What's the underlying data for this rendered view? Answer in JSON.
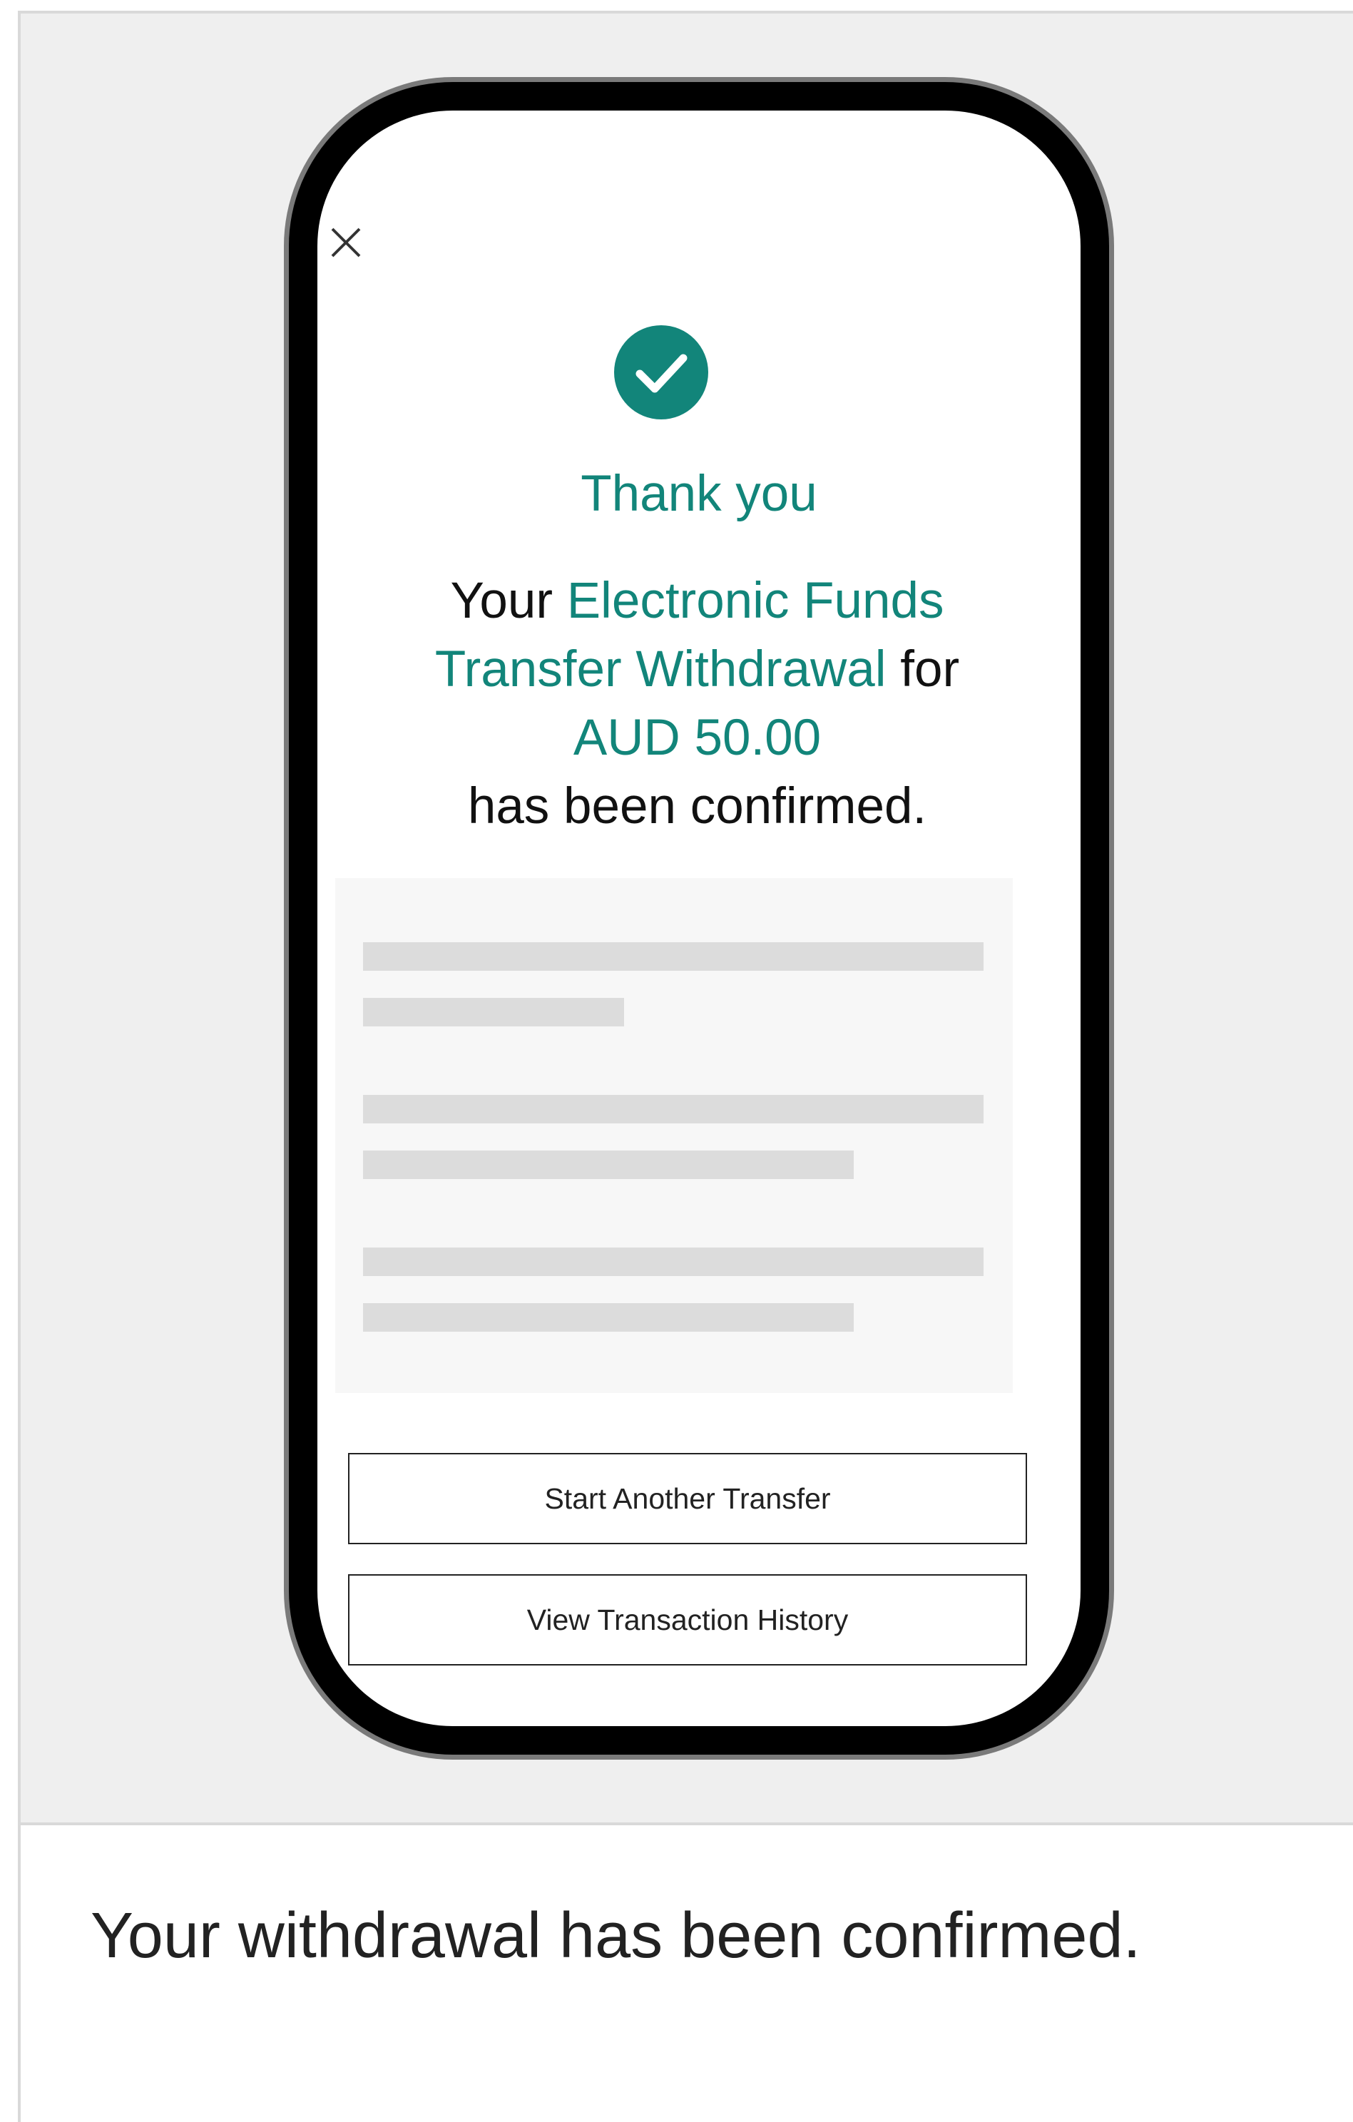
{
  "screen": {
    "thank_you": "Thank you",
    "message": {
      "prefix": "Your",
      "product": "Electronic Funds Transfer Withdrawal",
      "connector": "for",
      "amount": "AUD 50.00",
      "suffix": "has been confirmed."
    },
    "buttons": {
      "start_another_transfer": "Start Another Transfer",
      "view_transaction_history": "View Transaction History"
    },
    "icons": {
      "close": "close-icon",
      "success": "check-circle-icon"
    }
  },
  "caption": "Your withdrawal has been confirmed.",
  "colors": {
    "accent": "#12857a",
    "background": "#efefef",
    "phone_frame": "#000000",
    "skeleton": "#dcdcdc"
  }
}
